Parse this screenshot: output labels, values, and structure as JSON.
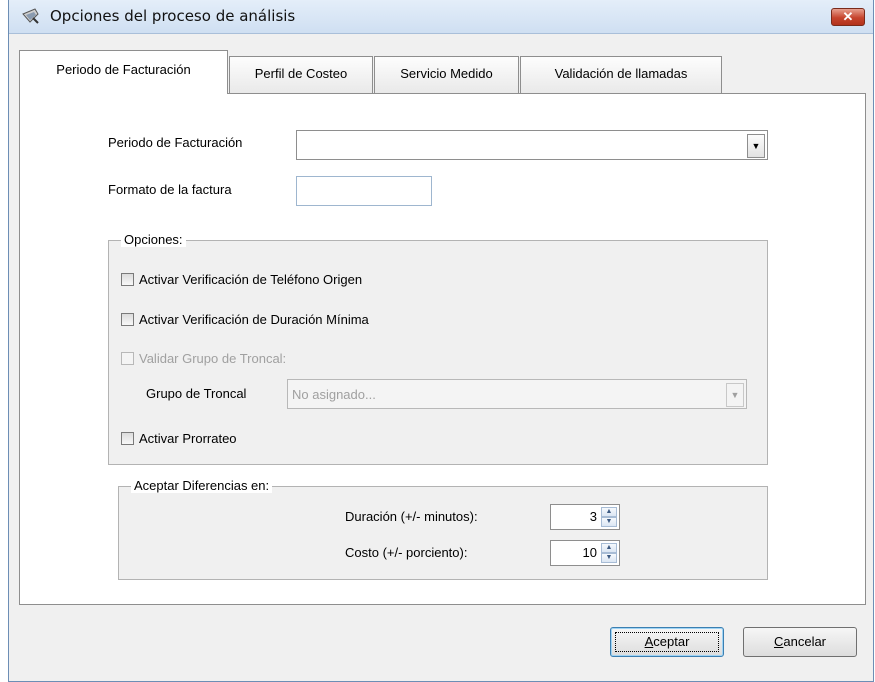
{
  "window": {
    "title": "Opciones del proceso de análisis",
    "icon": "process-settings-icon",
    "close_symbol": "✕"
  },
  "tabs": [
    {
      "label": "Periodo de Facturación",
      "active": true
    },
    {
      "label": "Perfil de Costeo",
      "active": false
    },
    {
      "label": "Servicio Medido",
      "active": false
    },
    {
      "label": "Validación de llamadas",
      "active": false
    }
  ],
  "billing": {
    "period_label": "Periodo de Facturación",
    "period_value": "",
    "format_label": "Formato de la factura",
    "format_value": ""
  },
  "options": {
    "title": "Opciones:",
    "check_origin": {
      "label": "Activar Verificación de Teléfono Origen",
      "checked": false
    },
    "check_min_duration": {
      "label": "Activar Verificación de Duración Mínima",
      "checked": false
    },
    "check_trunk_group": {
      "label": "Validar Grupo de Troncal:",
      "checked": false,
      "enabled": false
    },
    "trunk_group_label": "Grupo de Troncal",
    "trunk_group_value": "No asignado...",
    "check_proration": {
      "label": "Activar Prorrateo",
      "checked": false
    }
  },
  "differences": {
    "title": "Aceptar Diferencias en:",
    "duration_label": "Duración (+/- minutos):",
    "duration_value": "3",
    "cost_label": "Costo (+/- porciento):",
    "cost_value": "10"
  },
  "buttons": {
    "accept_first": "A",
    "accept_rest": "ceptar",
    "cancel_first": "C",
    "cancel_rest": "ancelar"
  },
  "colors": {
    "close_button": "#c6442d",
    "titlebar": "#cfdff2",
    "default_button_border": "#3c7fb1"
  }
}
